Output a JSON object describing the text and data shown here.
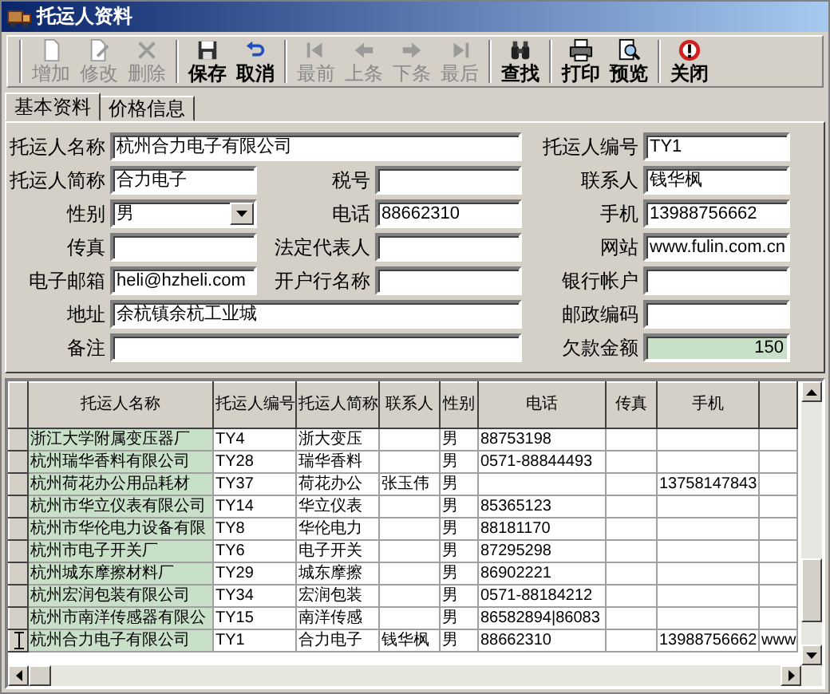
{
  "window": {
    "title": "托运人资料"
  },
  "toolbar_groups": [
    [
      {
        "label": "增加",
        "kind": "new",
        "disabled": true
      },
      {
        "label": "修改",
        "kind": "edit",
        "disabled": true
      },
      {
        "label": "删除",
        "kind": "delete",
        "disabled": true
      }
    ],
    [
      {
        "label": "保存",
        "kind": "save",
        "disabled": false
      },
      {
        "label": "取消",
        "kind": "undo",
        "disabled": false
      }
    ],
    [
      {
        "label": "最前",
        "kind": "first",
        "disabled": true
      },
      {
        "label": "上条",
        "kind": "prev",
        "disabled": true
      },
      {
        "label": "下条",
        "kind": "next",
        "disabled": true
      },
      {
        "label": "最后",
        "kind": "last",
        "disabled": true
      }
    ],
    [
      {
        "label": "查找",
        "kind": "find",
        "disabled": false
      }
    ],
    [
      {
        "label": "打印",
        "kind": "print",
        "disabled": false
      },
      {
        "label": "预览",
        "kind": "preview",
        "disabled": false
      }
    ],
    [
      {
        "label": "关闭",
        "kind": "close",
        "disabled": false
      }
    ]
  ],
  "tabs": [
    {
      "label": "基本资料",
      "selected": true
    },
    {
      "label": "价格信息",
      "selected": false
    }
  ],
  "form_rows": [
    [
      {
        "label": "托运人名称",
        "kind": "wide",
        "value": "杭州合力电子有限公司"
      },
      {
        "label": "托运人编号",
        "kind": "text",
        "value": "TY1"
      }
    ],
    [
      {
        "label": "托运人简称",
        "kind": "text",
        "value": "合力电子"
      },
      {
        "label": "税号",
        "kind": "text"
      },
      {
        "label": "联系人",
        "kind": "text",
        "value": "钱华枫"
      }
    ],
    [
      {
        "label": "性别",
        "kind": "select",
        "value": "男"
      },
      {
        "label": "电话",
        "kind": "text",
        "value": "88662310"
      },
      {
        "label": "手机",
        "kind": "text",
        "value": "13988756662"
      }
    ],
    [
      {
        "label": "传真",
        "kind": "text"
      },
      {
        "label": "法定代表人",
        "kind": "text"
      },
      {
        "label": "网站",
        "kind": "text",
        "value": "www.fulin.com.cn"
      }
    ],
    [
      {
        "label": "电子邮箱",
        "kind": "text",
        "value": "heli@hzheli.com"
      },
      {
        "label": "开户行名称",
        "kind": "text"
      },
      {
        "label": "银行帐户",
        "kind": "text"
      }
    ],
    [
      {
        "label": "地址",
        "kind": "wide",
        "value": "余杭镇余杭工业城"
      },
      {
        "label": "邮政编码",
        "kind": "text"
      }
    ],
    [
      {
        "label": "备注",
        "kind": "wide"
      },
      {
        "label": "欠款金额",
        "kind": "amount",
        "value": "150"
      }
    ]
  ],
  "table": {
    "columns": [
      "托运人名称",
      "托运人编号",
      "托运人简称",
      "联系人",
      "性别",
      "电话",
      "传真",
      "手机"
    ],
    "rows": [
      {
        "current": false,
        "name": "浙江大学附属变压器厂",
        "code": "TY4",
        "short_name": "浙大变压",
        "gender": "男",
        "phone": "88753198"
      },
      {
        "current": false,
        "name": "杭州瑞华香料有限公司",
        "code": "TY28",
        "short_name": "瑞华香料",
        "gender": "男",
        "phone": "0571-88844493"
      },
      {
        "current": false,
        "name": "杭州荷花办公用品耗材",
        "code": "TY37",
        "short_name": "荷花办公",
        "contact": "张玉伟",
        "gender": "男",
        "mobile": "13758147843"
      },
      {
        "current": false,
        "name": "杭州市华立仪表有限公司",
        "code": "TY14",
        "short_name": "华立仪表",
        "gender": "男",
        "phone": "85365123"
      },
      {
        "current": false,
        "name": "杭州市华伦电力设备有限",
        "code": "TY8",
        "short_name": "华伦电力",
        "gender": "男",
        "phone": "88181170"
      },
      {
        "current": false,
        "name": "杭州市电子开关厂",
        "code": "TY6",
        "short_name": "电子开关",
        "gender": "男",
        "phone": "87295298"
      },
      {
        "current": false,
        "name": "杭州城东摩擦材料厂",
        "code": "TY29",
        "short_name": "城东摩擦",
        "gender": "男",
        "phone": "86902221"
      },
      {
        "current": false,
        "name": "杭州宏润包装有限公司",
        "code": "TY34",
        "short_name": "宏润包装",
        "gender": "男",
        "phone": "0571-88184212"
      },
      {
        "current": false,
        "name": "杭州市南洋传感器有限公",
        "code": "TY15",
        "short_name": "南洋传感",
        "gender": "男",
        "phone": "86582894|86083"
      },
      {
        "current": true,
        "name": "杭州合力电子有限公司",
        "code": "TY1",
        "short_name": "合力电子",
        "contact": "钱华枫",
        "gender": "男",
        "phone": "88662310",
        "mobile": "13988756662",
        "column_9": "www"
      }
    ]
  }
}
